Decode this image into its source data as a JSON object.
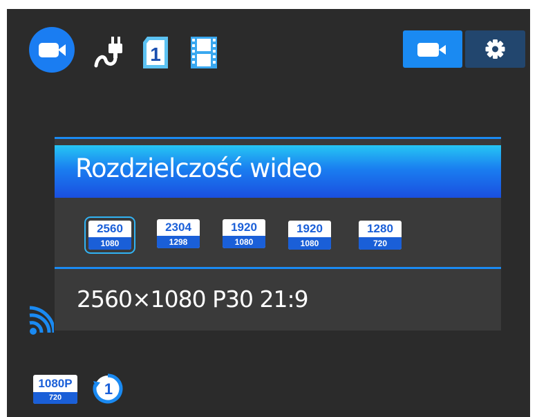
{
  "status_icons": {
    "mode": "video-camera-icon",
    "power": "power-plug-icon",
    "card": "sd-card-icon",
    "card_number": "1",
    "film": "film-icon"
  },
  "top_buttons": [
    {
      "name": "video-mode-button",
      "icon": "video-camera-icon"
    },
    {
      "name": "settings-button",
      "icon": "gear-icon"
    }
  ],
  "dialog": {
    "title": "Rozdzielczość wideo",
    "options": [
      {
        "top": "2560",
        "bottom": "1080",
        "selected": true
      },
      {
        "top": "2304",
        "bottom": "1298",
        "selected": false
      },
      {
        "top": "1920",
        "bottom": "1080",
        "selected": false
      },
      {
        "top": "1920",
        "bottom": "1080",
        "selected": false
      },
      {
        "top": "1280",
        "bottom": "720",
        "selected": false
      }
    ],
    "detail": "2560×1080 P30 21:9"
  },
  "bottom_status": {
    "resolution_top": "1080P",
    "resolution_bottom": "720",
    "timer_value": "1"
  },
  "colors": {
    "accent": "#1a8af2",
    "badge_blue": "#1a5fd8",
    "background": "#2b2b2b",
    "panel": "#3a3a3a"
  }
}
